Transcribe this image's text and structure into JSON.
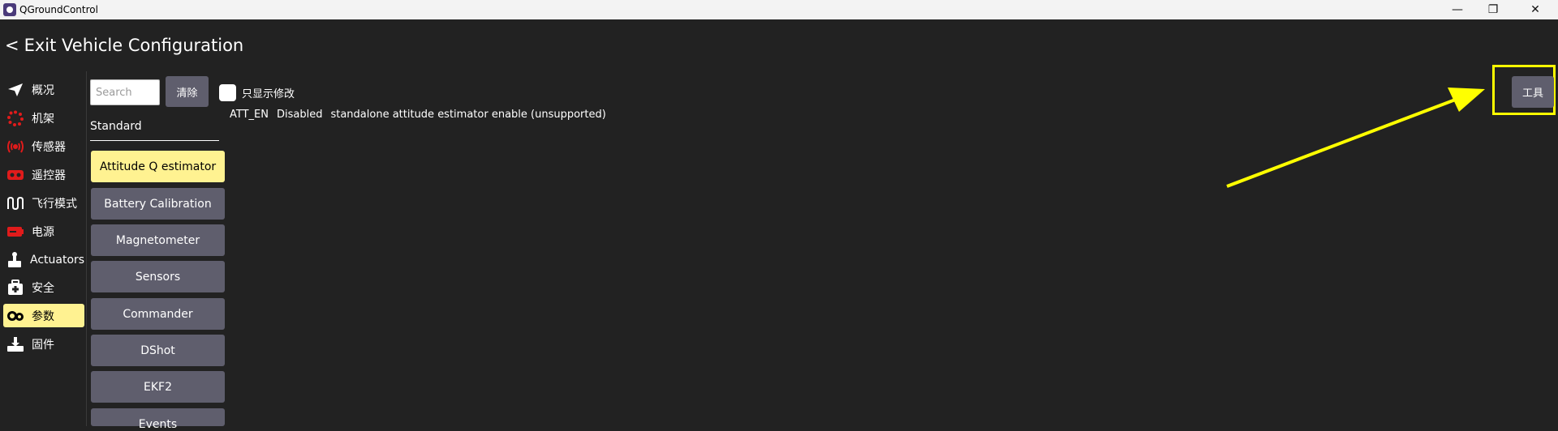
{
  "window": {
    "title": "QGroundControl",
    "minimize_glyph": "—",
    "restore_glyph": "❐",
    "close_glyph": "✕"
  },
  "header": {
    "back_glyph": "<",
    "title": "Exit Vehicle Configuration"
  },
  "nav": {
    "items": [
      {
        "label": "概况",
        "icon": "paper-plane-icon"
      },
      {
        "label": "机架",
        "icon": "airframe-icon"
      },
      {
        "label": "传感器",
        "icon": "radio-waves-icon"
      },
      {
        "label": "遥控器",
        "icon": "rc-controller-icon"
      },
      {
        "label": "飞行模式",
        "icon": "flight-modes-icon"
      },
      {
        "label": "电源",
        "icon": "battery-icon"
      },
      {
        "label": "Actuators",
        "icon": "actuator-icon"
      },
      {
        "label": "安全",
        "icon": "medkit-icon"
      },
      {
        "label": "参数",
        "icon": "gears-icon",
        "active": true
      },
      {
        "label": "固件",
        "icon": "firmware-icon"
      }
    ]
  },
  "params": {
    "search_placeholder": "Search",
    "clear_label": "清除",
    "category": "Standard",
    "groups": [
      "Attitude Q estimator",
      "Battery Calibration",
      "Magnetometer",
      "Sensors",
      "Commander",
      "DShot",
      "EKF2",
      "Events"
    ],
    "active_group": "Attitude Q estimator",
    "show_modified_label": "只显示修改",
    "rows": [
      {
        "name": "ATT_EN",
        "value": "Disabled",
        "description": "standalone attitude estimator enable (unsupported)"
      }
    ]
  },
  "tools": {
    "label": "工具"
  },
  "colors": {
    "background": "#222222",
    "button": "#5f5e6d",
    "active": "#fff291",
    "annotation": "#ffff00"
  }
}
